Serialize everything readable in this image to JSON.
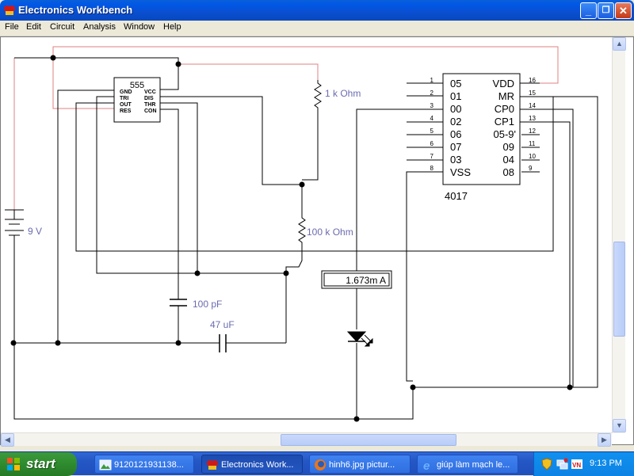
{
  "window": {
    "title": "Electronics Workbench",
    "buttons": {
      "minimize": "_",
      "maximize": "❐",
      "close": "✕"
    }
  },
  "menubar": {
    "items": [
      "File",
      "Edit",
      "Circuit",
      "Analysis",
      "Window",
      "Help"
    ]
  },
  "schematic": {
    "ic_555": {
      "name": "555",
      "pins_left": [
        "GND",
        "TRI",
        "OUT",
        "RES"
      ],
      "pins_right": [
        "VCC",
        "DIS",
        "THR",
        "CON"
      ]
    },
    "ic_4017": {
      "name": "4017",
      "pin_numbers_left": [
        "1",
        "2",
        "3",
        "4",
        "5",
        "6",
        "7",
        "8"
      ],
      "pin_labels_left": [
        "05",
        "01",
        "00",
        "02",
        "06",
        "07",
        "03",
        "VSS"
      ],
      "pin_numbers_right": [
        "16",
        "15",
        "14",
        "13",
        "12",
        "11",
        "10",
        "9"
      ],
      "pin_labels_right": [
        "VDD",
        "MR",
        "CP0",
        "CP1",
        "05-9'",
        "09",
        "04",
        "08"
      ]
    },
    "labels": {
      "r1": "1 k Ohm",
      "r2": "100 k Ohm",
      "battery": "9 V",
      "c1": "100 pF",
      "c2": "47 uF",
      "ammeter": "1.673m A"
    },
    "colors": {
      "wire": "#000000",
      "power_wire": "#e08080",
      "label": "#6b6bb0"
    }
  },
  "taskbar": {
    "start_label": "start",
    "tasks": [
      {
        "label": "9120121931138...",
        "icon": "image-viewer-icon",
        "active": false
      },
      {
        "label": "Electronics Work...",
        "icon": "ewb-icon",
        "active": true
      },
      {
        "label": "hinh6.jpg pictur...",
        "icon": "firefox-icon",
        "active": false
      },
      {
        "label": "giúp làm mạch le...",
        "icon": "ie-icon",
        "active": false
      }
    ],
    "clock": "9:13 PM"
  }
}
